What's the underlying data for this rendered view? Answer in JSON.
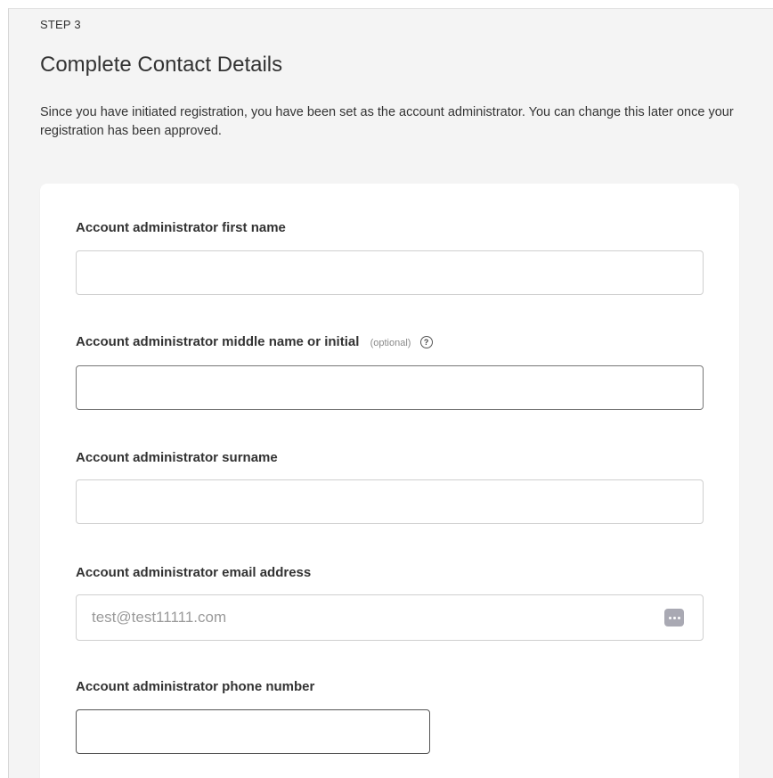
{
  "step": {
    "label": "STEP 3"
  },
  "heading": {
    "title": "Complete Contact Details"
  },
  "intro": {
    "text": "Since you have initiated registration, you have been set as the account administrator. You can change this later once your registration has been approved."
  },
  "form": {
    "first_name": {
      "label": "Account administrator first name",
      "value": ""
    },
    "middle_name": {
      "label": "Account administrator middle name or initial",
      "optional_tag": "(optional)",
      "help_glyph": "?",
      "value": ""
    },
    "surname": {
      "label": "Account administrator surname",
      "value": ""
    },
    "email": {
      "label": "Account administrator email address",
      "value": "test@test11111.com",
      "autofill_icon": "more-dots-icon"
    },
    "phone": {
      "label": "Account administrator phone number",
      "value": ""
    }
  }
}
